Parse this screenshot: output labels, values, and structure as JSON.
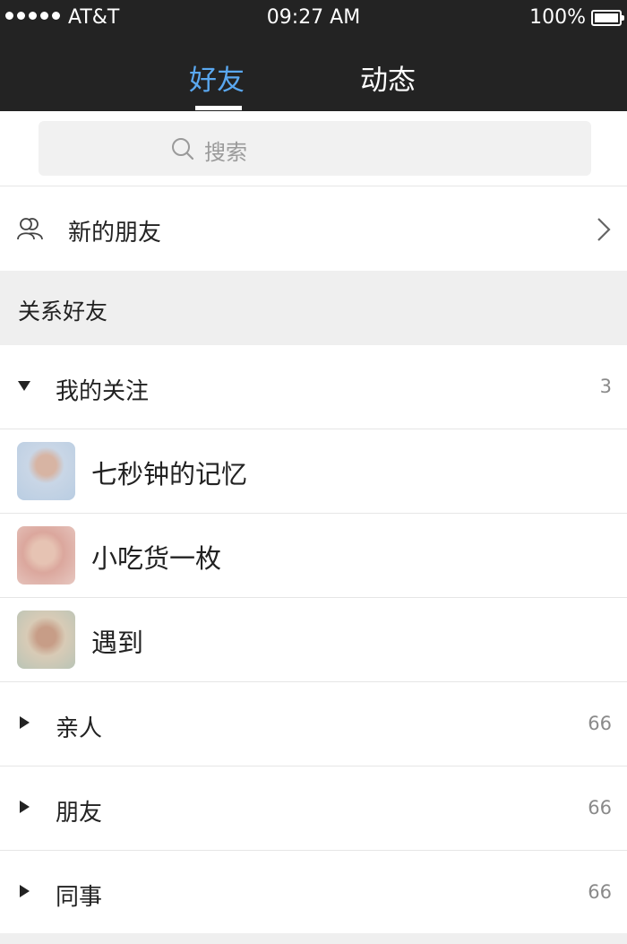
{
  "status_bar": {
    "carrier": "AT&T",
    "time": "09:27 AM",
    "battery": "100%"
  },
  "tabs": [
    {
      "label": "好友",
      "active": true
    },
    {
      "label": "动态",
      "active": false
    }
  ],
  "colors": {
    "header_bg": "#232323",
    "active_tab": "#5aa8f0",
    "section_bg": "#efefef"
  },
  "search": {
    "placeholder": "搜索",
    "icon": "search-icon"
  },
  "new_friends": {
    "label": "新的朋友",
    "icon": "friends-icon"
  },
  "section": {
    "title": "关系好友"
  },
  "groups": [
    {
      "label": "我的关注",
      "count": "3",
      "expanded": true,
      "members": [
        {
          "name": "七秒钟的记忆"
        },
        {
          "name": "小吃货一枚"
        },
        {
          "name": "遇到"
        }
      ]
    },
    {
      "label": "亲人",
      "count": "66",
      "expanded": false
    },
    {
      "label": "朋友",
      "count": "66",
      "expanded": false
    },
    {
      "label": "同事",
      "count": "66",
      "expanded": false
    }
  ]
}
